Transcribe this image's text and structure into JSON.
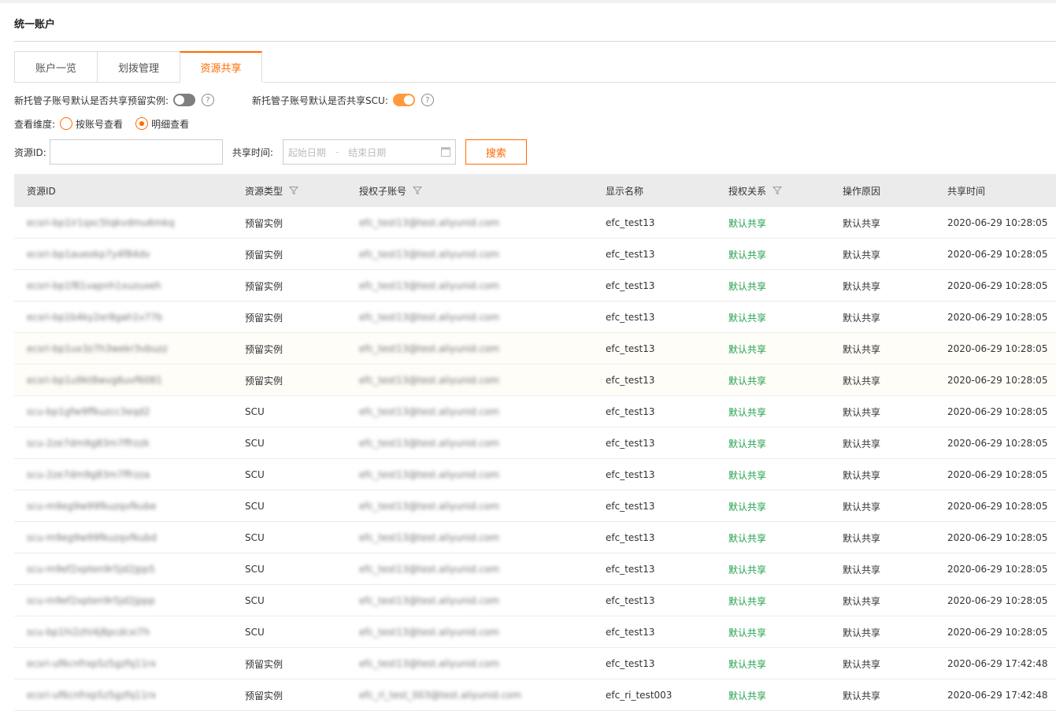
{
  "app": {
    "title": "统一账户"
  },
  "tabs": [
    {
      "label": "账户一览"
    },
    {
      "label": "划拨管理"
    },
    {
      "label": "资源共享"
    }
  ],
  "options": {
    "ri_share_label": "新托管子账号默认是否共享预留实例:",
    "ri_share_on": false,
    "scu_share_label": "新托管子账号默认是否共享SCU:",
    "scu_share_on": true,
    "help_glyph": "?"
  },
  "view": {
    "label": "查看维度:",
    "options": [
      {
        "label": "按账号查看",
        "checked": false
      },
      {
        "label": "明细查看",
        "checked": true
      }
    ]
  },
  "filters": {
    "resource_id_label": "资源ID:",
    "resource_id_value": "",
    "share_time_label": "共享时间:",
    "start_placeholder": "起始日期",
    "range_sep": "-",
    "end_placeholder": "结束日期",
    "search_label": "搜索"
  },
  "colors": {
    "accent": "#ff6a00",
    "green": "#22a04b"
  },
  "table": {
    "headers": [
      "资源ID",
      "资源类型",
      "授权子账号",
      "显示名称",
      "授权关系",
      "操作原因",
      "共享时间"
    ],
    "filterable": [
      false,
      true,
      true,
      false,
      true,
      false,
      false
    ],
    "rows": [
      {
        "id": "ecsri-bp1ir1qxc5tqkvdmu6mkq",
        "type": "预留实例",
        "account": "efc_test13@test.aliyunid.com",
        "name": "efc_test13",
        "relation": "默认共享",
        "reason": "默认共享",
        "time": "2020-06-29 10:28:05"
      },
      {
        "id": "ecsri-bp1aueokp7y4f84dv",
        "type": "预留实例",
        "account": "efc_test13@test.aliyunid.com",
        "name": "efc_test13",
        "relation": "默认共享",
        "reason": "默认共享",
        "time": "2020-06-29 10:28:05"
      },
      {
        "id": "ecsri-bp1f81vapnh1xuzuxeh",
        "type": "预留实例",
        "account": "efc_test13@test.aliyunid.com",
        "name": "efc_test13",
        "relation": "默认共享",
        "reason": "默认共享",
        "time": "2020-06-29 10:28:05"
      },
      {
        "id": "ecsri-bp1b4ky2er8gah1v77b",
        "type": "预留实例",
        "account": "efc_test13@test.aliyunid.com",
        "name": "efc_test13",
        "relation": "默认共享",
        "reason": "默认共享",
        "time": "2020-06-29 10:28:05"
      },
      {
        "id": "ecsri-bp1ux3z7h3wekr3vbuzz",
        "type": "预留实例",
        "account": "efc_test13@test.aliyunid.com",
        "name": "efc_test13",
        "relation": "默认共享",
        "reason": "默认共享",
        "time": "2020-06-29 10:28:05"
      },
      {
        "id": "ecsri-bp1u9kt8wvg6uvf6081",
        "type": "预留实例",
        "account": "efc_test13@test.aliyunid.com",
        "name": "efc_test13",
        "relation": "默认共享",
        "reason": "默认共享",
        "time": "2020-06-29 10:28:05"
      },
      {
        "id": "scu-bp1gfw9ffkuzcc3eqd2",
        "type": "SCU",
        "account": "efc_test13@test.aliyunid.com",
        "name": "efc_test13",
        "relation": "默认共享",
        "reason": "默认共享",
        "time": "2020-06-29 10:28:05"
      },
      {
        "id": "scu-2ze7dm9g83m7ffrzzk",
        "type": "SCU",
        "account": "efc_test13@test.aliyunid.com",
        "name": "efc_test13",
        "relation": "默认共享",
        "reason": "默认共享",
        "time": "2020-06-29 10:28:05"
      },
      {
        "id": "scu-2ze7dm9g83m7ffrzza",
        "type": "SCU",
        "account": "efc_test13@test.aliyunid.com",
        "name": "efc_test13",
        "relation": "默认共享",
        "reason": "默认共享",
        "time": "2020-06-29 10:28:05"
      },
      {
        "id": "scu-m9eg9w99fkuzqvfkube",
        "type": "SCU",
        "account": "efc_test13@test.aliyunid.com",
        "name": "efc_test13",
        "relation": "默认共享",
        "reason": "默认共享",
        "time": "2020-06-29 10:28:05"
      },
      {
        "id": "scu-m9eg9w99fkuzqvfkubd",
        "type": "SCU",
        "account": "efc_test13@test.aliyunid.com",
        "name": "efc_test13",
        "relation": "默认共享",
        "reason": "默认共享",
        "time": "2020-06-29 10:28:05"
      },
      {
        "id": "scu-m9ef2xpten9r5jd2jpp5",
        "type": "SCU",
        "account": "efc_test13@test.aliyunid.com",
        "name": "efc_test13",
        "relation": "默认共享",
        "reason": "默认共享",
        "time": "2020-06-29 10:28:05"
      },
      {
        "id": "scu-m9ef2xpten9r5jd2jppp",
        "type": "SCU",
        "account": "efc_test13@test.aliyunid.com",
        "name": "efc_test13",
        "relation": "默认共享",
        "reason": "默认共享",
        "time": "2020-06-29 10:28:05"
      },
      {
        "id": "scu-bp1hi2zhi4j8pcdcxi7h",
        "type": "SCU",
        "account": "efc_test13@test.aliyunid.com",
        "name": "efc_test13",
        "relation": "默认共享",
        "reason": "默认共享",
        "time": "2020-06-29 10:28:05"
      },
      {
        "id": "ecsri-uf6cnfrxp5z5gzfq11rx",
        "type": "预留实例",
        "account": "efc_test13@test.aliyunid.com",
        "name": "efc_test13",
        "relation": "默认共享",
        "reason": "默认共享",
        "time": "2020-06-29 17:42:48"
      },
      {
        "id": "ecsri-uf6cnfrxp5z5gzfq11rx",
        "type": "预留实例",
        "account": "efc_ri_test_003@test.aliyunid.com",
        "name": "efc_ri_test003",
        "relation": "默认共享",
        "reason": "默认共享",
        "time": "2020-06-29 17:42:48"
      }
    ]
  }
}
